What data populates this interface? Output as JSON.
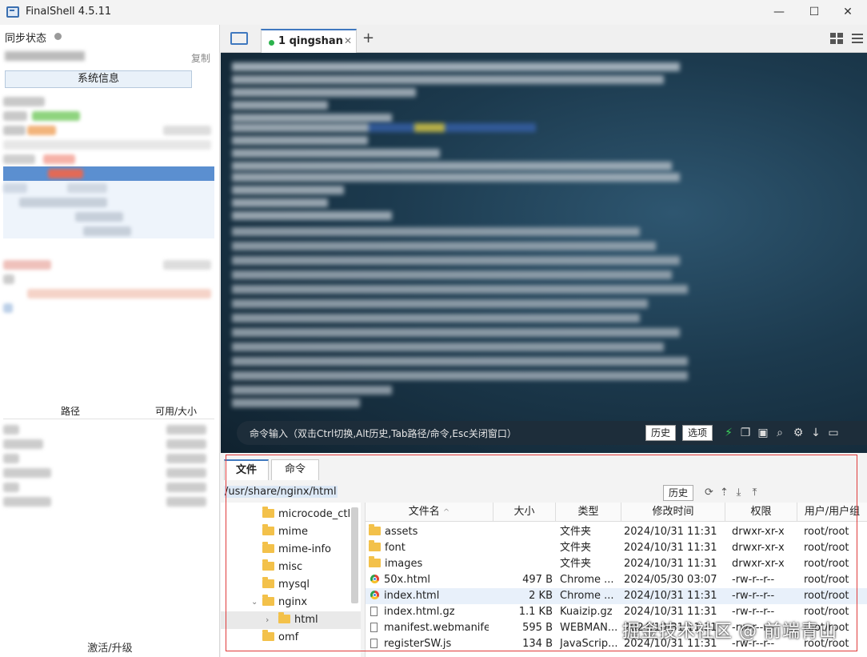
{
  "window": {
    "title": "FinalShell 4.5.11",
    "minimize": "—",
    "maximize": "☐",
    "close": "✕"
  },
  "sidebar": {
    "sync_status": "同步状态",
    "copy": "复制",
    "sysinfo_button": "系统信息",
    "table_headers": [
      "路径",
      "可用/大小"
    ],
    "activate": "激活/升级"
  },
  "tabs": [
    {
      "label": "1  qingshan",
      "status_color": "#2bb24c"
    }
  ],
  "terminal": {
    "command_hint": "命令输入（双击Ctrl切换,Alt历史,Tab路径/命令,Esc关闭窗口）",
    "history_button": "历史",
    "options_button": "选项"
  },
  "files_panel": {
    "tabs": [
      "文件",
      "命令"
    ],
    "path": "/usr/share/nginx/html",
    "history_button": "历史",
    "tree": [
      {
        "name": "microcode_ctl",
        "indent": 0,
        "expanded": false
      },
      {
        "name": "mime",
        "indent": 0
      },
      {
        "name": "mime-info",
        "indent": 0
      },
      {
        "name": "misc",
        "indent": 0
      },
      {
        "name": "mysql",
        "indent": 0
      },
      {
        "name": "nginx",
        "indent": 0,
        "expanded": true
      },
      {
        "name": "html",
        "indent": 1,
        "selected": true
      },
      {
        "name": "omf",
        "indent": 0
      }
    ],
    "columns": [
      "文件名",
      "大小",
      "类型",
      "修改时间",
      "权限",
      "用户/用户组"
    ],
    "files": [
      {
        "name": "assets",
        "size": "",
        "type": "文件夹",
        "mtime": "2024/10/31 11:31",
        "perm": "drwxr-xr-x",
        "owner": "root/root",
        "icon": "folder"
      },
      {
        "name": "font",
        "size": "",
        "type": "文件夹",
        "mtime": "2024/10/31 11:31",
        "perm": "drwxr-xr-x",
        "owner": "root/root",
        "icon": "folder"
      },
      {
        "name": "images",
        "size": "",
        "type": "文件夹",
        "mtime": "2024/10/31 11:31",
        "perm": "drwxr-xr-x",
        "owner": "root/root",
        "icon": "folder"
      },
      {
        "name": "50x.html",
        "size": "497 B",
        "type": "Chrome ...",
        "mtime": "2024/05/30 03:07",
        "perm": "-rw-r--r--",
        "owner": "root/root",
        "icon": "chrome"
      },
      {
        "name": "index.html",
        "size": "2 KB",
        "type": "Chrome ...",
        "mtime": "2024/10/31 11:31",
        "perm": "-rw-r--r--",
        "owner": "root/root",
        "icon": "chrome",
        "selected": true
      },
      {
        "name": "index.html.gz",
        "size": "1.1 KB",
        "type": "Kuaizip.gz",
        "mtime": "2024/10/31 11:31",
        "perm": "-rw-r--r--",
        "owner": "root/root",
        "icon": "file"
      },
      {
        "name": "manifest.webmanifest",
        "size": "595 B",
        "type": "WEBMAN...",
        "mtime": "2024/10/31 11:31",
        "perm": "-rw-r--r--",
        "owner": "root/root",
        "icon": "file"
      },
      {
        "name": "registerSW.js",
        "size": "134 B",
        "type": "JavaScrip...",
        "mtime": "2024/10/31 11:31",
        "perm": "-rw-r--r--",
        "owner": "root/root",
        "icon": "file"
      }
    ]
  },
  "watermark": "掘金技术社区 @ 前端青山"
}
